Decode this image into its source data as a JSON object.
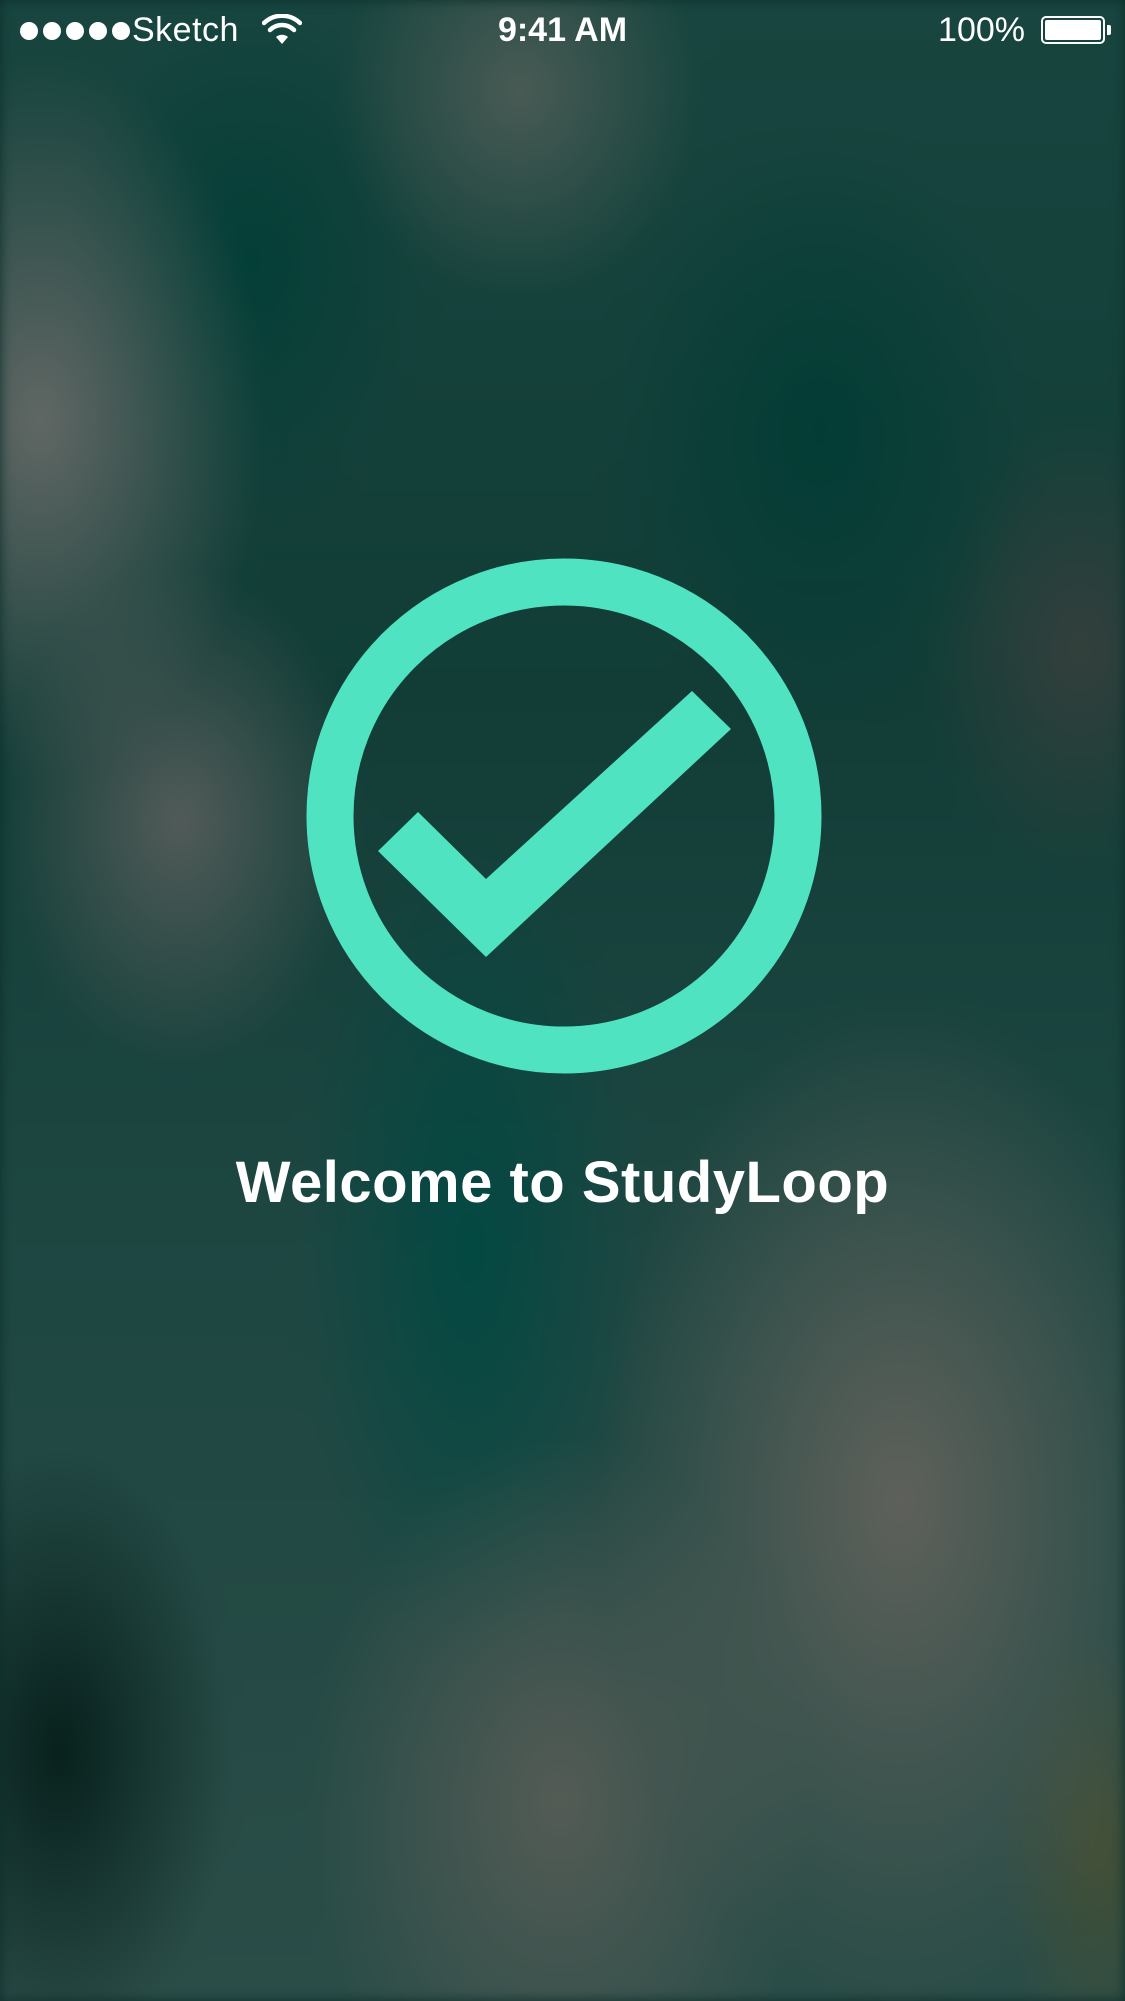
{
  "status_bar": {
    "carrier": "Sketch",
    "time": "9:41 AM",
    "battery_percent": "100%",
    "signal_bars": 5,
    "battery_level": 1.0,
    "icons": [
      "signal-dots-icon",
      "wifi-icon",
      "battery-icon"
    ]
  },
  "welcome": {
    "title": "Welcome to StudyLoop",
    "icon": "checkmark-circle-icon",
    "accent_color": "#50E3C2"
  }
}
